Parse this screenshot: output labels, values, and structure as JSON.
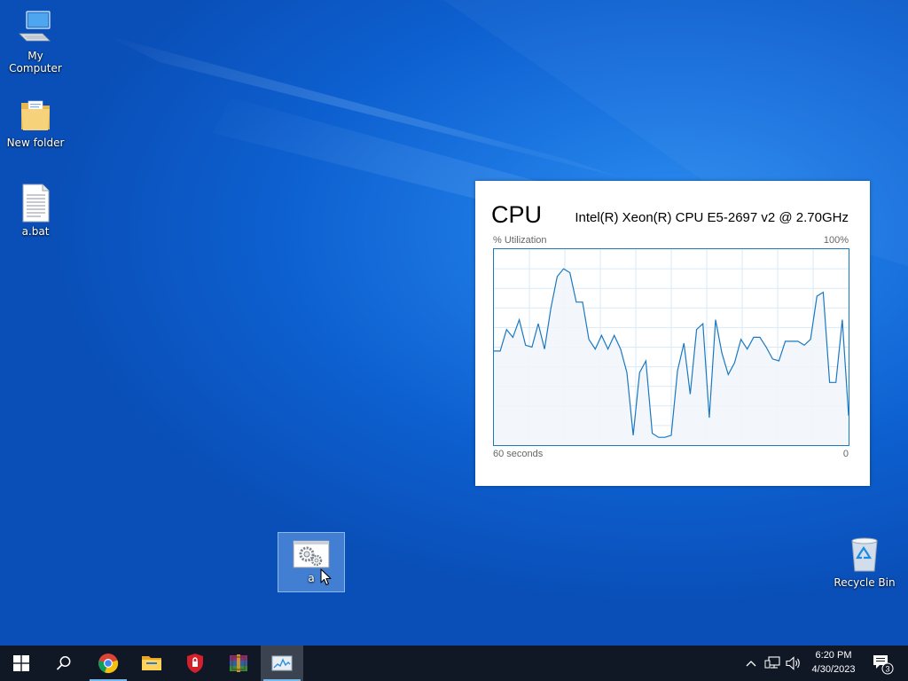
{
  "desktop": {
    "icons": [
      {
        "label": "My Computer",
        "icon": "computer-icon"
      },
      {
        "label": "New folder",
        "icon": "folder-icon"
      },
      {
        "label": "a.bat",
        "icon": "text-file-icon"
      },
      {
        "label": "a",
        "icon": "executable-gear-icon",
        "selected": true
      },
      {
        "label": "Recycle Bin",
        "icon": "recycle-bin-icon"
      }
    ]
  },
  "cpu_widget": {
    "title": "CPU",
    "model": "Intel(R) Xeon(R) CPU E5-2697 v2 @ 2.70GHz",
    "y_label": "% Utilization",
    "y_max_label": "100%",
    "x_start_label": "60 seconds",
    "x_end_label": "0",
    "line_color": "#1a78c2",
    "fill_color": "#f1f6fa",
    "grid_color": "#d9eaf7"
  },
  "chart_data": {
    "type": "area",
    "title": "CPU",
    "ylabel": "% Utilization",
    "ylim": [
      0,
      100
    ],
    "xlabel": "60 seconds",
    "x_range_seconds": [
      60,
      0
    ],
    "grid": true,
    "series": [
      {
        "values": [
          48,
          48,
          59,
          55,
          64,
          51,
          50,
          62,
          49,
          70,
          86,
          90,
          88,
          73,
          73,
          54,
          49,
          56,
          49,
          56,
          49,
          37,
          5,
          37,
          43,
          6,
          4,
          4,
          5,
          38,
          52,
          26,
          59,
          62,
          14,
          64,
          47,
          36,
          42,
          54,
          49,
          55,
          55,
          50,
          44,
          43,
          53,
          53,
          53,
          51,
          54,
          76,
          78,
          32,
          32,
          64,
          15
        ]
      }
    ]
  },
  "taskbar": {
    "items": [
      {
        "icon": "windows-start-icon"
      },
      {
        "icon": "search-icon"
      },
      {
        "icon": "chrome-icon"
      },
      {
        "icon": "file-explorer-icon"
      },
      {
        "icon": "shield-icon"
      },
      {
        "icon": "winrar-icon"
      },
      {
        "icon": "task-manager-icon",
        "active": true
      }
    ],
    "tray": {
      "chevron": "chevron-up-icon",
      "network": "network-icon",
      "volume": "volume-icon",
      "time": "6:20 PM",
      "date": "4/30/2023",
      "notifications_count": "3"
    }
  }
}
